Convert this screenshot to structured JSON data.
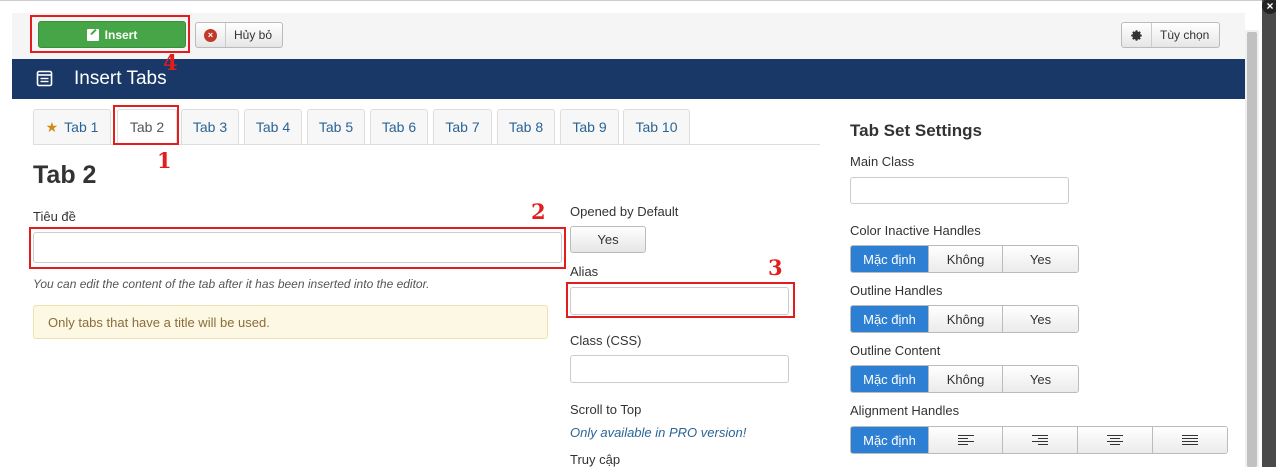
{
  "toolbar": {
    "insert_label": "Insert",
    "cancel_label": "Hủy bỏ",
    "options_label": "Tùy chọn"
  },
  "header": {
    "title": "Insert Tabs"
  },
  "tabs": [
    {
      "label": "Tab 1",
      "icon": "star-icon"
    },
    {
      "label": "Tab 2"
    },
    {
      "label": "Tab 3"
    },
    {
      "label": "Tab 4"
    },
    {
      "label": "Tab 5"
    },
    {
      "label": "Tab 6"
    },
    {
      "label": "Tab 7"
    },
    {
      "label": "Tab 8"
    },
    {
      "label": "Tab 9"
    },
    {
      "label": "Tab 10"
    }
  ],
  "active_tab": "Tab 2",
  "main": {
    "heading": "Tab 2",
    "title_label": "Tiêu đề",
    "title_value": "",
    "hint": "You can edit the content of the tab after it has been inserted into the editor.",
    "warning": "Only tabs that have a title will be used."
  },
  "middle": {
    "opened_label": "Opened by Default",
    "opened_value": "Yes",
    "alias_label": "Alias",
    "alias_value": "",
    "class_label": "Class (CSS)",
    "class_value": "",
    "scroll_label": "Scroll to Top",
    "scroll_note": "Only available in PRO version!",
    "access_label": "Truy cập"
  },
  "settings": {
    "title": "Tab Set Settings",
    "main_class_label": "Main Class",
    "main_class_value": "",
    "color_inactive_label": "Color Inactive Handles",
    "outline_handles_label": "Outline Handles",
    "outline_content_label": "Outline Content",
    "alignment_label": "Alignment Handles",
    "opt_default": "Mặc định",
    "opt_no": "Không",
    "opt_yes": "Yes",
    "selected": "Mặc định"
  },
  "annotations": [
    "1",
    "2",
    "3",
    "4"
  ],
  "colors": {
    "header_bg": "#1a3867",
    "insert_green": "#46a546",
    "selected_blue": "#2c7fd2",
    "annotation_red": "#e11d1d"
  }
}
